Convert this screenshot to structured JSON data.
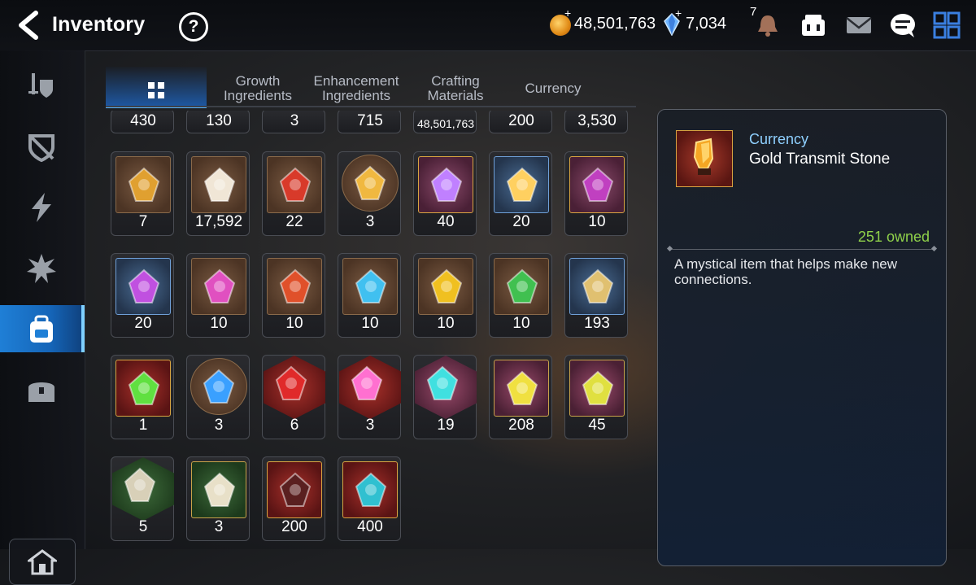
{
  "header": {
    "title": "Inventory",
    "help": "?",
    "gold": "48,501,763",
    "crystals": "7,034",
    "notification_count": "7",
    "icons": [
      "bell-icon",
      "shop-icon",
      "mail-icon",
      "chat-icon",
      "menu-grid-icon"
    ]
  },
  "sidebar": {
    "items": [
      {
        "icon": "sword-shield-icon",
        "active": false
      },
      {
        "icon": "shield-off-icon",
        "active": false
      },
      {
        "icon": "lightning-icon",
        "active": false
      },
      {
        "icon": "burst-icon",
        "active": false
      },
      {
        "icon": "backpack-icon",
        "active": true
      },
      {
        "icon": "treasure-chest-icon",
        "active": false
      }
    ],
    "home_icon": "lobby-icon"
  },
  "tabs": [
    {
      "label": "",
      "icon": "grid-icon",
      "active": true
    },
    {
      "label": "Growth\nIngredients",
      "active": false
    },
    {
      "label": "Enhancement\nIngredients",
      "active": false
    },
    {
      "label": "Crafting\nMaterials",
      "active": false
    },
    {
      "label": "Currency",
      "active": false
    }
  ],
  "grid": {
    "top_row_counts": [
      "430",
      "130",
      "3",
      "715",
      "48,501,763",
      "200",
      "3,530"
    ],
    "rows": [
      [
        {
          "icon": "banner-icon",
          "count": "7",
          "style": "brown"
        },
        {
          "icon": "knight-piece-icon",
          "count": "17,592",
          "style": "brown"
        },
        {
          "icon": "flame-leaf-icon",
          "count": "22",
          "style": "brown"
        },
        {
          "icon": "cat-portrait-icon",
          "count": "3",
          "style": "circle"
        },
        {
          "icon": "purple-flower-icon",
          "count": "40",
          "style": "purple"
        },
        {
          "icon": "gold-flower-icon",
          "count": "20",
          "style": "blue"
        },
        {
          "icon": "purple-hex-gem-icon",
          "count": "10",
          "style": "purple"
        }
      ],
      [
        {
          "icon": "purple-triangle-rune-icon",
          "count": "20",
          "style": "blue"
        },
        {
          "icon": "pink-rune-icon",
          "count": "10",
          "style": "brown"
        },
        {
          "icon": "red-rune-icon",
          "count": "10",
          "style": "brown"
        },
        {
          "icon": "blue-rune-icon",
          "count": "10",
          "style": "brown"
        },
        {
          "icon": "yellow-rune-icon",
          "count": "10",
          "style": "brown"
        },
        {
          "icon": "green-rune-icon",
          "count": "10",
          "style": "brown"
        },
        {
          "icon": "fish-branch-icon",
          "count": "193",
          "style": "blue"
        }
      ],
      [
        {
          "icon": "green-orb-icon",
          "count": "1",
          "style": "red"
        },
        {
          "icon": "blue-circuit-icon",
          "count": "3",
          "style": "circle"
        },
        {
          "icon": "red-gem-icon",
          "count": "6",
          "style": "hex-red"
        },
        {
          "icon": "potion-icon",
          "count": "3",
          "style": "hex-red"
        },
        {
          "icon": "star-stone-icon",
          "count": "19",
          "style": "hex-pink"
        },
        {
          "icon": "yellow-hammer-stone-icon",
          "count": "208",
          "style": "pink"
        },
        {
          "icon": "exclaim-stone-icon",
          "count": "45",
          "style": "pink"
        }
      ],
      [
        {
          "icon": "sparkle-stone-icon",
          "count": "5",
          "style": "hex-green"
        },
        {
          "icon": "seven-stone-icon",
          "count": "3",
          "style": "green"
        },
        {
          "icon": "dark-crystal-icon",
          "count": "200",
          "style": "red"
        },
        {
          "icon": "blue-crystal-icon",
          "count": "400",
          "style": "red"
        }
      ]
    ]
  },
  "detail": {
    "category": "Currency",
    "name": "Gold Transmit Stone",
    "owned": "251 owned",
    "description": "A mystical item that helps make new connections.",
    "icon": "gold-transmit-stone-icon"
  },
  "colors": {
    "accent_blue": "#1f7fd6",
    "owned_green": "#8fd14a",
    "category_blue": "#8fd0ff",
    "frame_gold": "#d9a441"
  }
}
